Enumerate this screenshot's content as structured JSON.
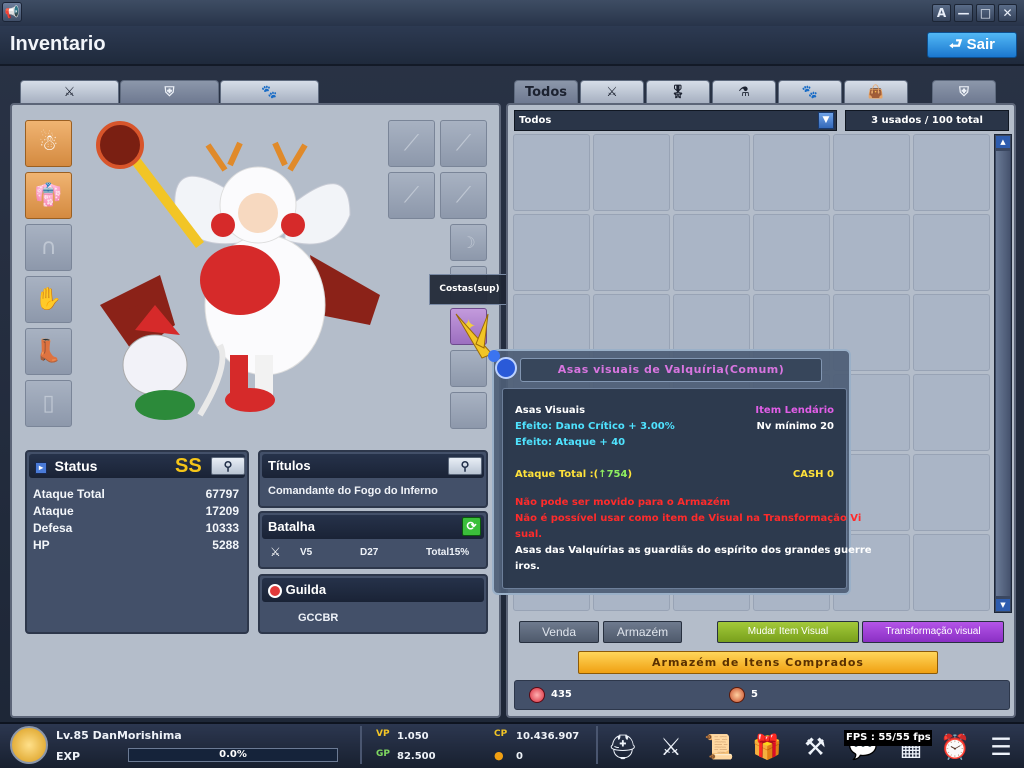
{
  "window": {
    "a_label": "A",
    "minimize": "—",
    "maximize": "□",
    "close": "✕"
  },
  "page_title": "Inventario",
  "exit_button": "Sair",
  "left_tabs": [
    "sword-icon",
    "armor-icon",
    "paw-icon"
  ],
  "right_tabs": {
    "all": "Todos"
  },
  "equip_slot_tooltip": "Costas(sup)",
  "status": {
    "title": "Status",
    "grade": "SS",
    "rows": [
      {
        "label": "Ataque Total",
        "value": "67797"
      },
      {
        "label": "Ataque",
        "value": "17209"
      },
      {
        "label": "Defesa",
        "value": "10333"
      },
      {
        "label": "HP",
        "value": "5288"
      }
    ]
  },
  "titles": {
    "title": "Títulos",
    "value": "Comandante do Fogo do Inferno"
  },
  "battle": {
    "title": "Batalha",
    "rank": "V5",
    "division": "D27",
    "total": "Total15%"
  },
  "guild": {
    "title": "Guilda",
    "name": "GCCBR"
  },
  "filter": {
    "selected": "Todos",
    "usage": "3 usados / 100 total"
  },
  "tooltip": {
    "title": "Asas visuais de Valquíria(Comum)",
    "type": "Asas Visuais",
    "rarity": "Item Lendário",
    "effect1": "Efeito: Dano Crítico + 3.00%",
    "level": "Nv mínimo 20",
    "effect2": "Efeito: Ataque + 40",
    "attack_label": "Ataque Total :(",
    "attack_value": "↑754",
    "attack_close": ")",
    "cash": "CASH 0",
    "warn1": "Não pode ser movido para o Armazém",
    "warn2a": "Não é possível usar como item de Visual na Transformação Vi",
    "warn2b": "sual.",
    "desc1": "Asas das Valquírias as guardiãs do espírito dos grandes guerre",
    "desc2": "iros."
  },
  "buttons": {
    "sell": "Venda",
    "storage": "Armazém",
    "change_visual": "Mudar Item Visual",
    "transform_visual": "Transformação visual",
    "purchased_storage": "Armazém de Itens Comprados"
  },
  "currency": {
    "gems": "435",
    "tokens": "5"
  },
  "player": {
    "name": "Lv.85 DanMorishima",
    "exp_label": "EXP",
    "exp_value": "0.0%",
    "exp_fraction": 0.0,
    "vp_value": "1.050",
    "gp_value": "82.500",
    "cp_value": "10.436.907",
    "coin_value": "0",
    "fps": "FPS : 55/55 fps"
  },
  "colors": {
    "legend": "#e25ee8",
    "effect": "#4fe3ff",
    "yellow": "#ffe23a",
    "red": "#ff2b2b",
    "green": "#8ff060"
  }
}
